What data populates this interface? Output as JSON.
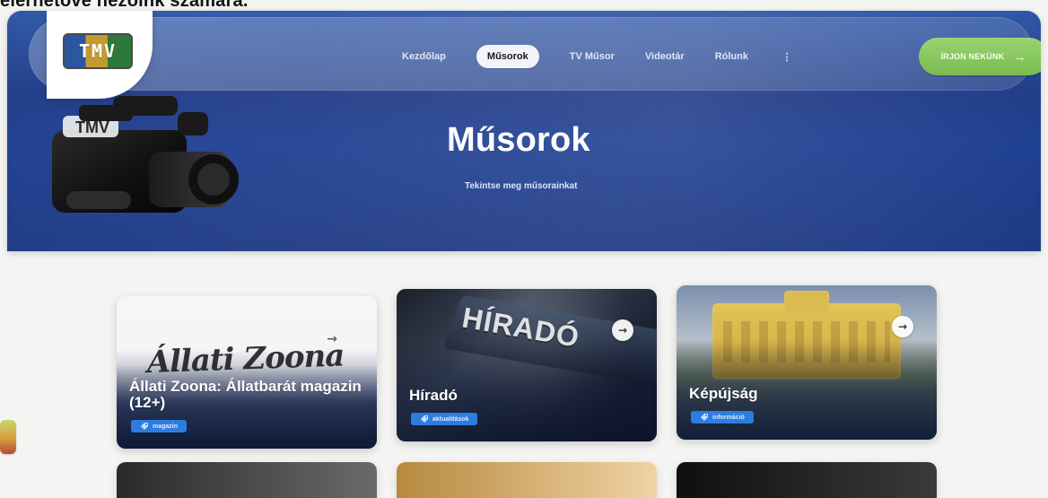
{
  "page": {
    "top_text": "elérhetővé nézőink számára."
  },
  "header": {
    "logo_text": "TMV",
    "nav": {
      "items": [
        {
          "label": "Kezdőlap"
        },
        {
          "label": "Műsorok"
        },
        {
          "label": "TV Műsor"
        },
        {
          "label": "Videotár"
        },
        {
          "label": "Rólunk"
        }
      ],
      "more_label": "⋮",
      "cta_label": "ÍRJON NEKÜNK",
      "cta_arrow": "→"
    }
  },
  "hero": {
    "title": "Műsorok",
    "subtitle": "Tekintse meg műsorainkat"
  },
  "cards": [
    {
      "title": "Állati Zoona: Állatbarát magazin (12+)",
      "tag": "magazin",
      "arrow": "→"
    },
    {
      "title": "Híradó",
      "tag": "aktualitások",
      "arrow": "→"
    },
    {
      "title": "Képújság",
      "tag": "információ",
      "arrow": "→"
    }
  ],
  "colors": {
    "hero_blue": "#203c88",
    "cta_green": "#86c75c",
    "tag_blue": "#2d7de0"
  }
}
